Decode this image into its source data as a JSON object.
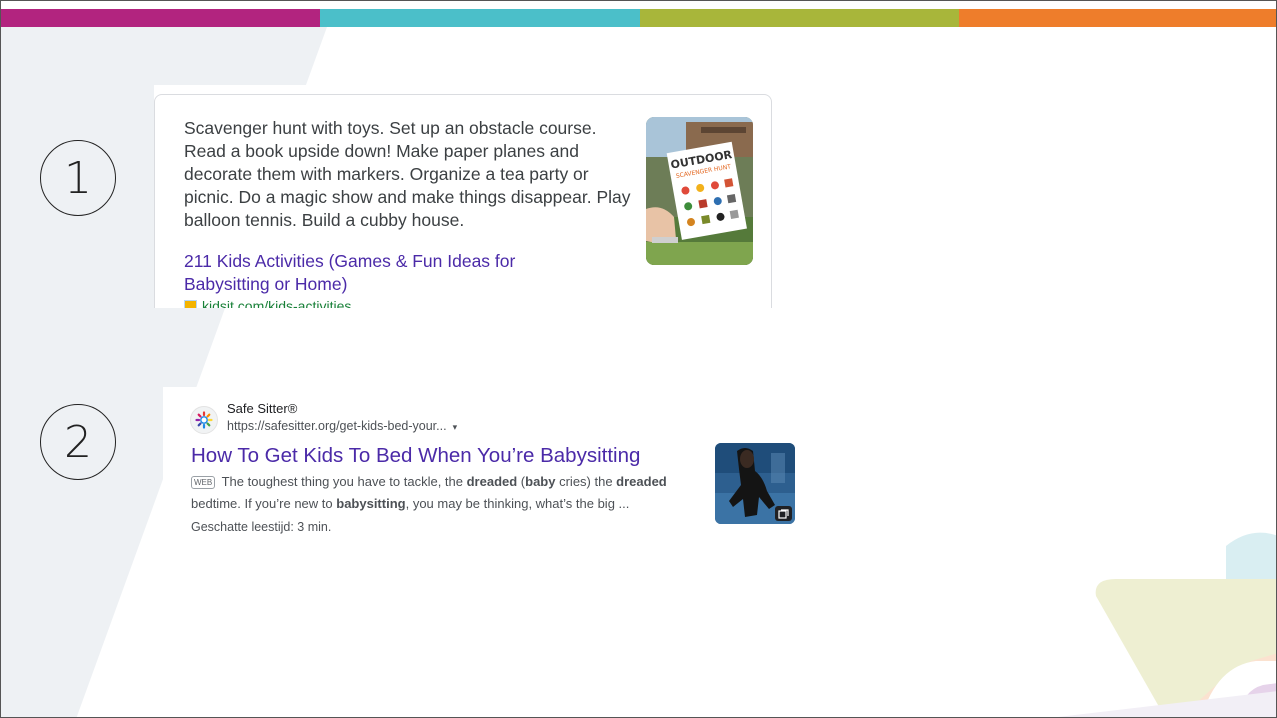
{
  "colors": {
    "bar": [
      "#b2247f",
      "#4bbfc9",
      "#a8b63a",
      "#ee7d2b"
    ],
    "link": "#4b2aa8",
    "url_green": "#188038"
  },
  "markers": [
    "1",
    "2"
  ],
  "result1": {
    "snippet": "Scavenger hunt with toys. Set up an obstacle course. Read a book upside down! Make paper planes and decorate them with markers. Organize a tea party or picnic. Do a magic show and make things disappear. Play balloon tennis. Build a cubby house.",
    "title": "211 Kids Activities (Games & Fun Ideas for Babysitting or Home)",
    "url": "kidsit.com/kids-activities",
    "thumb_text_line1": "OUTDOOR",
    "thumb_text_line2": "SCAVENGER HUNT",
    "favicon": "kidsit-favicon-icon"
  },
  "result2": {
    "site_name": "Safe Sitter®",
    "site_url": "https://safesitter.org/get-kids-bed-your...",
    "caret": "▾",
    "title": "How To Get Kids To Bed When You’re Babysitting",
    "badge": "WEB",
    "desc_1": " The toughest thing you have to tackle, the ",
    "desc_b1": "dreaded",
    "desc_2": " (",
    "desc_b2": "baby",
    "desc_3": " cries) the ",
    "desc_b3": "dreaded",
    "desc_4": " bedtime. If you’re new to ",
    "desc_b4": "babysitting",
    "desc_5": ", you may be thinking, what’s the big ...",
    "read_time": "Geschatte leestijd: 3 min.",
    "favicon": "safesitter-sun-icon",
    "thumb_icon": "video-icon"
  }
}
